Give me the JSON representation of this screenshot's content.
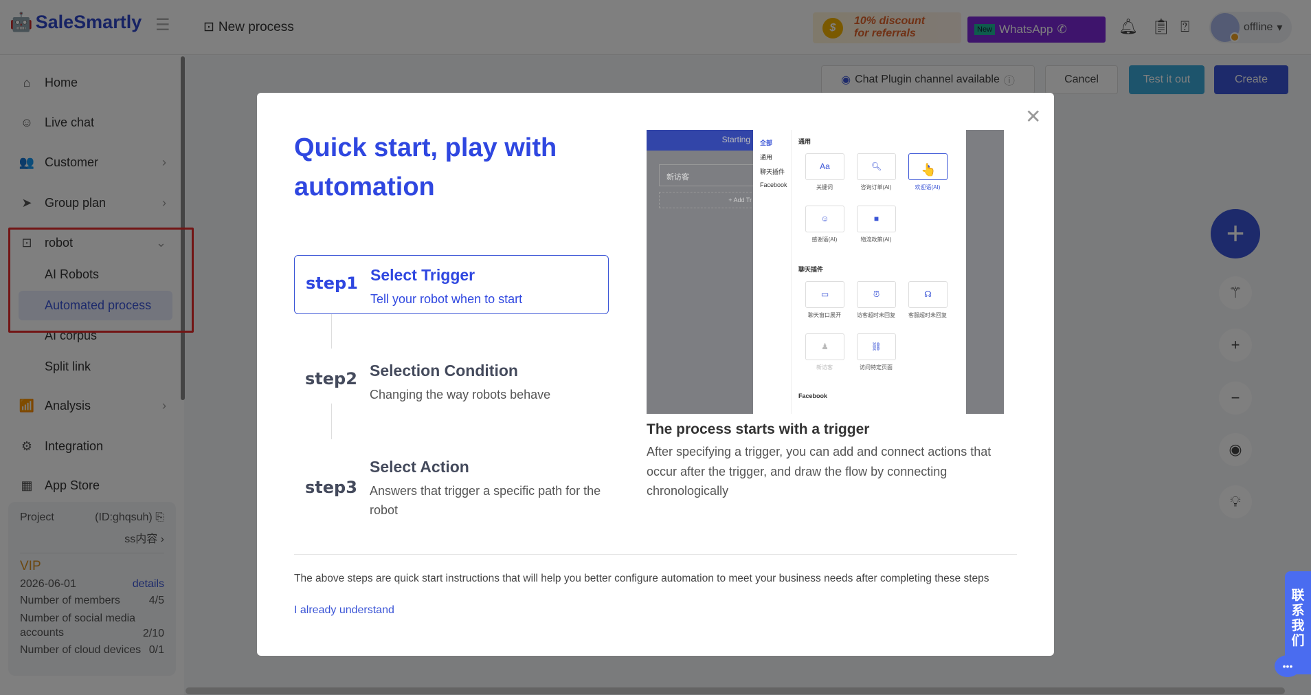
{
  "header": {
    "brand": "SaleSmartly",
    "page_title": "New process",
    "discount_line1": "10% discount",
    "discount_line2": "for referrals",
    "whatsapp_badge": "New",
    "whatsapp_label": "WhatsApp",
    "status": "offline"
  },
  "sidebar": {
    "items": [
      {
        "label": "Home",
        "icon": "⌂"
      },
      {
        "label": "Live chat",
        "icon": "☺"
      },
      {
        "label": "Customer",
        "icon": "👥"
      },
      {
        "label": "Group plan",
        "icon": "➤"
      },
      {
        "label": "robot",
        "icon": "⊡"
      },
      {
        "label": "Analysis",
        "icon": "📶"
      },
      {
        "label": "Integration",
        "icon": "⚙"
      },
      {
        "label": "App Store",
        "icon": "▦"
      }
    ],
    "sub_items": [
      "AI Robots",
      "Automated process",
      "AI corpus",
      "Split link"
    ],
    "project": {
      "label": "Project",
      "id": "(ID:ghqsuh)",
      "name": "ss内容",
      "plan": "VIP",
      "expiry": "2026-06-01",
      "details": "details",
      "members_label": "Number of members",
      "members": "4/5",
      "social_label": "Number of social media accounts",
      "social": "2/10",
      "cloud_label": "Number of cloud devices",
      "cloud": "0/1"
    }
  },
  "toolbar": {
    "channel": "Chat Plugin channel available",
    "cancel": "Cancel",
    "test": "Test it out",
    "create": "Create"
  },
  "modal": {
    "title": "Quick start, play with automation",
    "steps": [
      {
        "num": "step1",
        "title": "Select Trigger",
        "desc": "Tell your robot when to start"
      },
      {
        "num": "step2",
        "title": "Selection Condition",
        "desc": "Changing the way robots behave"
      },
      {
        "num": "step3",
        "title": "Select Action",
        "desc": "Answers that trigger a specific path for the robot"
      }
    ],
    "preview": {
      "starting": "Starting",
      "visitor": "新访客",
      "add": "+ Add Tr",
      "tabs": [
        "全部",
        "通用",
        "聊天插件",
        "Facebook"
      ],
      "sec1": "通用",
      "sec2": "聊天插件",
      "sec3": "Facebook",
      "cards1": [
        "关键词",
        "咨询订单(AI)",
        "欢迎语(AI)",
        "感谢语(AI)",
        "物流政策(AI)"
      ],
      "cards2": [
        "聊天窗口展开",
        "访客超时未回复",
        "客服超时未回复",
        "新访客",
        "访问特定页面"
      ]
    },
    "caption": "The process starts with a trigger",
    "caption_desc": "After specifying a trigger, you can add and connect actions that occur after the trigger, and draw the flow by connecting chronologically",
    "footer": "The above steps are quick start instructions that will help you better configure automation to meet your business needs after completing these steps",
    "ack": "I already understand"
  },
  "contact": "联系我们",
  "colors": {
    "primary": "#3b55d6",
    "highlight": "#e52b2b",
    "test": "#3aa8d8"
  }
}
